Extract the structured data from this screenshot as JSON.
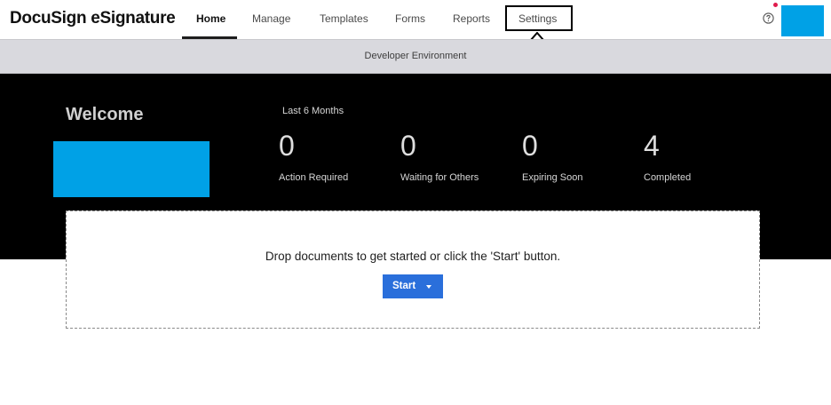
{
  "brand": {
    "logo_text": "DocuSign eSignature"
  },
  "nav": {
    "home": "Home",
    "manage": "Manage",
    "templates": "Templates",
    "forms": "Forms",
    "reports": "Reports",
    "settings": "Settings"
  },
  "header_icons": {
    "help": "help-circle-icon",
    "notification_color": "#e01b4c",
    "avatar_color": "#00a1e6"
  },
  "banner": {
    "text": "Developer Environment"
  },
  "hero": {
    "welcome": "Welcome",
    "period": "Last 6 Months",
    "stats": [
      {
        "value": "0",
        "label": "Action Required"
      },
      {
        "value": "0",
        "label": "Waiting for Others"
      },
      {
        "value": "0",
        "label": "Expiring Soon"
      },
      {
        "value": "4",
        "label": "Completed"
      }
    ]
  },
  "dropzone": {
    "text": "Drop documents to get started or click the 'Start' button.",
    "start_label": "Start"
  },
  "colors": {
    "accent": "#2a6fdb",
    "hero_bg": "#000000",
    "banner_bg": "#d9d9de"
  }
}
